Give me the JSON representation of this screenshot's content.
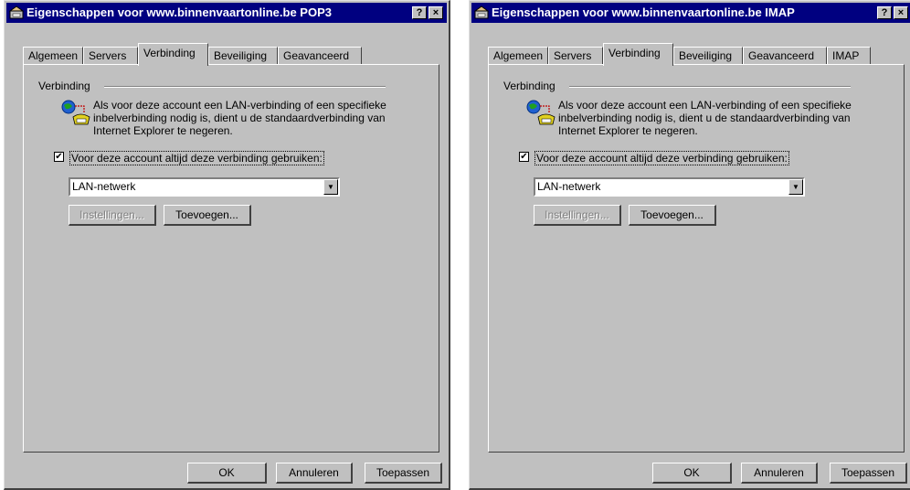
{
  "dialogs": [
    {
      "title": "Eigenschappen voor www.binnenvaartonline.be POP3",
      "help_glyph": "?",
      "close_glyph": "×",
      "tabs": [
        "Algemeen",
        "Servers",
        "Verbinding",
        "Beveiliging",
        "Geavanceerd"
      ],
      "active_tab": "Verbinding",
      "group_label": "Verbinding",
      "info_text": "Als voor deze account een LAN-verbinding of een specifieke inbelverbinding nodig is, dient u de standaardverbinding van Internet Explorer te negeren.",
      "checkbox_label": "Voor deze account altijd deze verbinding gebruiken:",
      "checkbox_checked": true,
      "checkbox_mark": "✔",
      "connection_value": "LAN-netwerk",
      "combo_arrow": "▼",
      "instellingen_label": "Instellingen...",
      "toevoegen_label": "Toevoegen...",
      "ok_label": "OK",
      "annuleren_label": "Annuleren",
      "toepassen_label": "Toepassen"
    },
    {
      "title": "Eigenschappen voor www.binnenvaartonline.be IMAP",
      "help_glyph": "?",
      "close_glyph": "×",
      "tabs": [
        "Algemeen",
        "Servers",
        "Verbinding",
        "Beveiliging",
        "Geavanceerd",
        "IMAP"
      ],
      "active_tab": "Verbinding",
      "group_label": "Verbinding",
      "info_text": "Als voor deze account een LAN-verbinding of een specifieke inbelverbinding nodig is, dient u de standaardverbinding van Internet Explorer te negeren.",
      "checkbox_label": "Voor deze account altijd deze verbinding gebruiken:",
      "checkbox_checked": true,
      "checkbox_mark": "✔",
      "connection_value": "LAN-netwerk",
      "combo_arrow": "▼",
      "instellingen_label": "Instellingen...",
      "toevoegen_label": "Toevoegen...",
      "ok_label": "OK",
      "annuleren_label": "Annuleren",
      "toepassen_label": "Toepassen"
    }
  ],
  "colors": {
    "face": "#c0c0c0",
    "title_bar": "#000080",
    "title_text": "#ffffff"
  }
}
